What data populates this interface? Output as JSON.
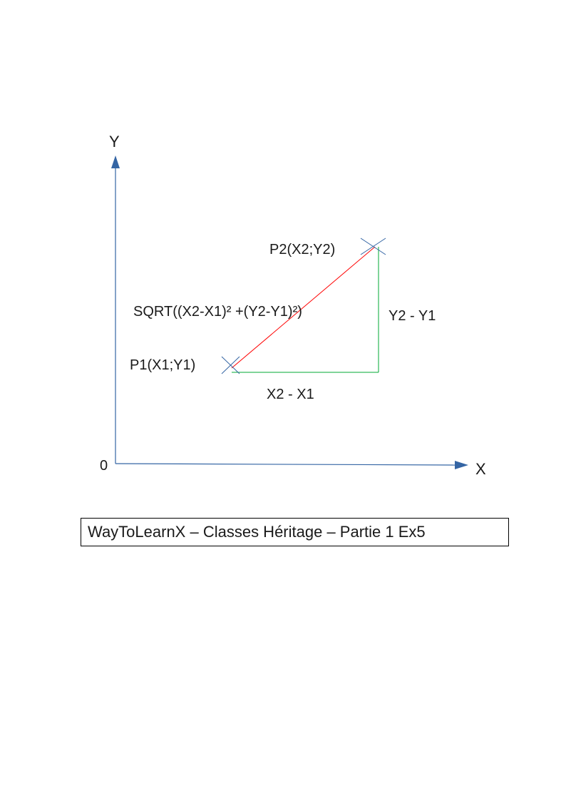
{
  "diagram": {
    "axis_y_label": "Y",
    "axis_x_label": "X",
    "origin_label": "0",
    "p1_label": "P1(X1;Y1)",
    "p2_label": "P2(X2;Y2)",
    "distance_formula": "SQRT((X2-X1)² +(Y2-Y1)²)",
    "dx_label": "X2 - X1",
    "dy_label": "Y2 - Y1",
    "colors": {
      "axes": "#3465a4",
      "hypotenuse": "#ff0000",
      "legs": "#00a933",
      "markers": "#3465a4"
    }
  },
  "caption": {
    "text": "WayToLearnX – Classes Héritage – Partie 1 Ex5"
  }
}
